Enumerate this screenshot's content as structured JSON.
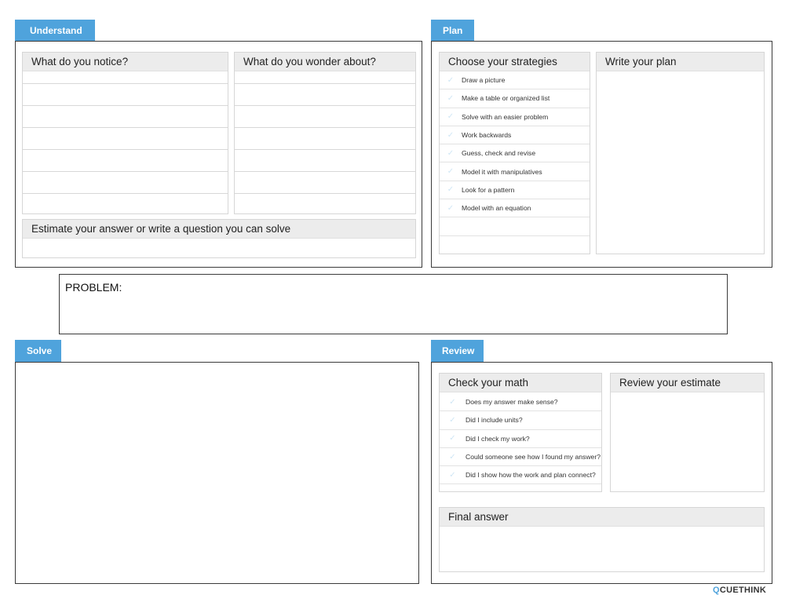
{
  "understand": {
    "tab": "Understand",
    "notice": {
      "title": "What do you notice?"
    },
    "wonder": {
      "title": "What do you wonder about?"
    },
    "estimate": {
      "title": "Estimate your answer or write a question you can solve"
    }
  },
  "plan": {
    "tab": "Plan",
    "strategies": {
      "title": "Choose your strategies",
      "items": [
        "Draw a picture",
        "Make a table or organized list",
        "Solve with an easier problem",
        "Work backwards",
        "Guess, check and revise",
        "Model it with manipulatives",
        "Look for a pattern",
        "Model with an equation"
      ]
    },
    "write_plan": {
      "title": "Write your plan"
    }
  },
  "problem": {
    "label": "PROBLEM:"
  },
  "solve": {
    "tab": "Solve"
  },
  "review": {
    "tab": "Review",
    "check_math": {
      "title": "Check your math",
      "items": [
        "Does my answer make sense?",
        "Did I include units?",
        "Did I check my work?",
        "Could someone see how I found my answer?",
        "Did I show how the work and plan connect?"
      ]
    },
    "review_estimate": {
      "title": "Review your estimate"
    },
    "final_answer": {
      "title": "Final answer"
    }
  },
  "brand": {
    "logo_q": "Q",
    "logo_cue": "CUE",
    "logo_think": "THINK"
  },
  "colors": {
    "accent": "#4fa3dc",
    "panel_header": "#ececec",
    "frame_border": "#3a3a3a"
  }
}
